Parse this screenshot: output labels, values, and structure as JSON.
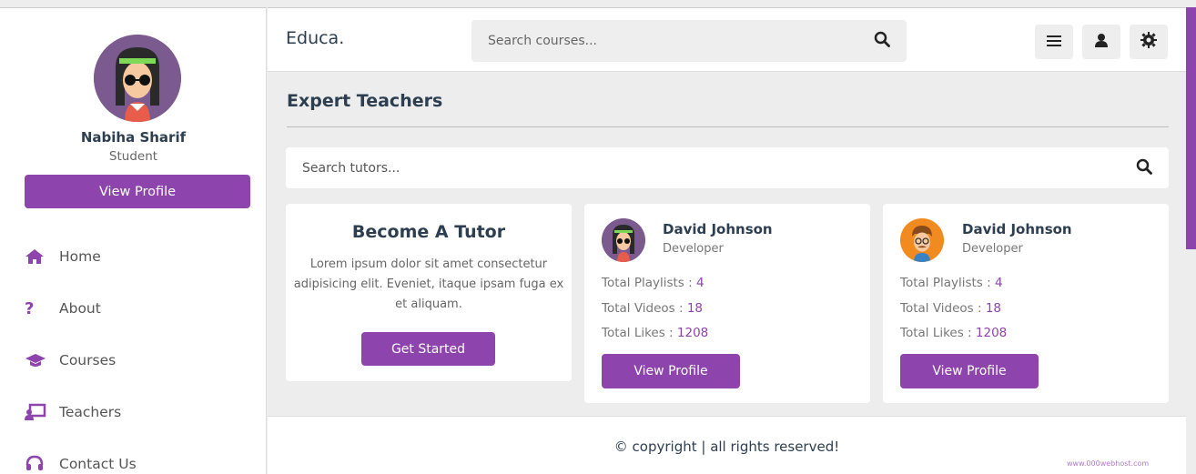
{
  "user": {
    "name": "Nabiha Sharif",
    "role": "Student",
    "view_profile_label": "View Profile"
  },
  "nav": [
    {
      "label": "Home",
      "icon": "home-icon"
    },
    {
      "label": "About",
      "icon": "question-icon"
    },
    {
      "label": "Courses",
      "icon": "graduation-cap-icon"
    },
    {
      "label": "Teachers",
      "icon": "chalkboard-teacher-icon"
    },
    {
      "label": "Contact Us",
      "icon": "headset-icon"
    }
  ],
  "header": {
    "logo": "Educa.",
    "search_placeholder": "Search courses...",
    "icons": [
      "menu-icon",
      "user-icon",
      "settings-icon"
    ]
  },
  "main": {
    "title": "Expert Teachers",
    "tutor_search_placeholder": "Search tutors...",
    "become_tutor": {
      "title": "Become A Tutor",
      "text": "Lorem ipsum dolor sit amet consectetur adipisicing elit. Eveniet, itaque ipsam fuga ex et aliquam.",
      "button": "Get Started"
    },
    "teachers": [
      {
        "name": "David Johnson",
        "role": "Developer",
        "stats": [
          {
            "label": "Total Playlists : ",
            "value": "4"
          },
          {
            "label": "Total Videos : ",
            "value": "18"
          },
          {
            "label": "Total Likes : ",
            "value": "1208"
          }
        ],
        "button": "View Profile"
      },
      {
        "name": "David Johnson",
        "role": "Developer",
        "stats": [
          {
            "label": "Total Playlists : ",
            "value": "4"
          },
          {
            "label": "Total Videos : ",
            "value": "18"
          },
          {
            "label": "Total Likes : ",
            "value": "1208"
          }
        ],
        "button": "View Profile"
      }
    ]
  },
  "footer": {
    "text": "© copyright | all rights reserved!"
  },
  "watermark": "www.000webhost.com",
  "colors": {
    "accent": "#8e44ad",
    "background": "#ededed",
    "text": "#2c3e50"
  }
}
